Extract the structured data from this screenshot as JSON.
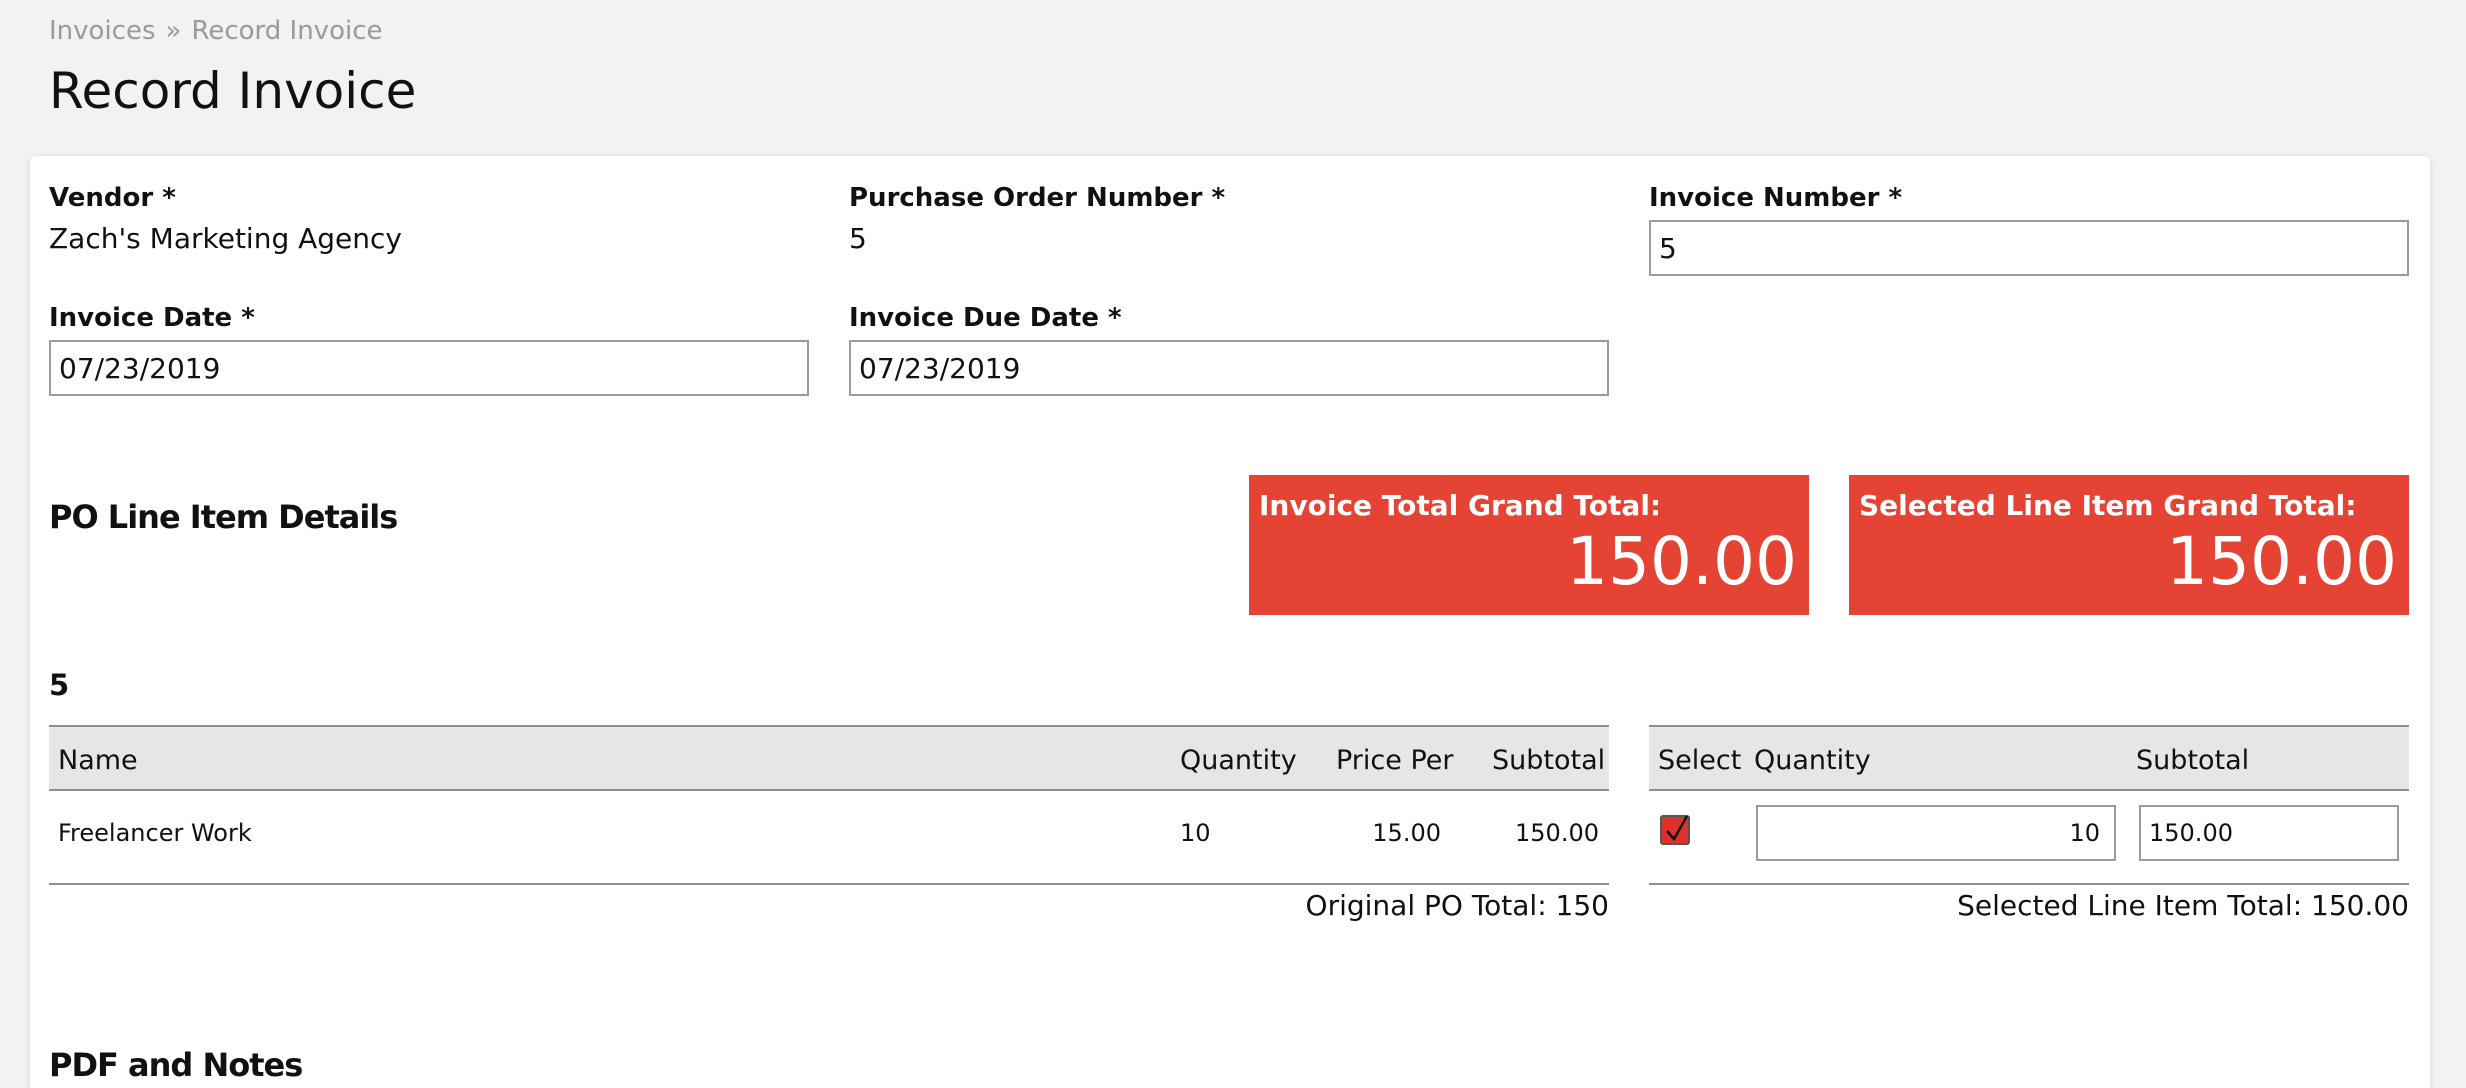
{
  "breadcrumb": {
    "parent": "Invoices",
    "separator": "»",
    "current": "Record Invoice"
  },
  "page_title": "Record Invoice",
  "vendor": {
    "label": "Vendor *",
    "value": "Zach's Marketing Agency"
  },
  "po_number": {
    "label": "Purchase Order Number *",
    "value": "5"
  },
  "invoice_number": {
    "label": "Invoice Number *",
    "value": "5"
  },
  "invoice_date": {
    "label": "Invoice Date *",
    "value": "07/23/2019"
  },
  "invoice_due_date": {
    "label": "Invoice Due Date *",
    "value": "07/23/2019"
  },
  "line_items_section": {
    "title": "PO Line Item Details",
    "po_ref": "5"
  },
  "totals": {
    "invoice_total": {
      "label": "Invoice Total Grand Total:",
      "value": "150.00"
    },
    "selected_total": {
      "label": "Selected Line Item Grand Total:",
      "value": "150.00"
    },
    "color": "#e54434"
  },
  "po_table": {
    "headers": [
      "Name",
      "Quantity",
      "Price Per",
      "Subtotal"
    ],
    "rows": [
      {
        "name": "Freelancer Work",
        "quantity": "10",
        "price_per": "15.00",
        "subtotal": "150.00"
      }
    ],
    "footer": "Original PO Total: 150"
  },
  "select_table": {
    "headers": [
      "Select",
      "Quantity",
      "Subtotal"
    ],
    "rows": [
      {
        "selected": true,
        "quantity": "10",
        "subtotal": "150.00"
      }
    ],
    "footer": "Selected Line Item Total: 150.00"
  },
  "pdf_section": {
    "title": "PDF and Notes"
  }
}
